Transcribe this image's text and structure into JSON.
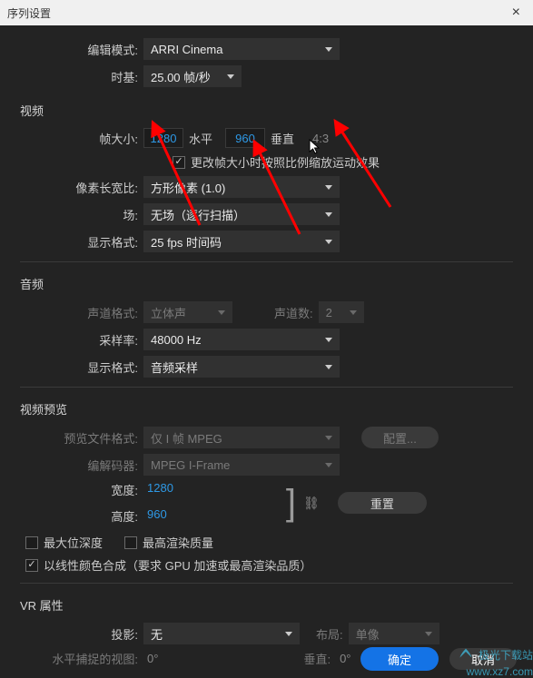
{
  "window": {
    "title": "序列设置",
    "close": "×"
  },
  "header": {
    "edit_mode_label": "编辑模式:",
    "edit_mode_value": "ARRI Cinema",
    "timebase_label": "时基:",
    "timebase_value": "25.00 帧/秒"
  },
  "video": {
    "section": "视频",
    "frame_size_label": "帧大小:",
    "width": "1280",
    "horiz_label": "水平",
    "height": "960",
    "vert_label": "垂直",
    "aspect": "4:3",
    "scale_checkbox_label": "更改帧大小时按照比例缩放运动效果",
    "pixel_aspect_label": "像素长宽比:",
    "pixel_aspect_value": "方形像素 (1.0)",
    "field_label": "场:",
    "field_value": "无场（逐行扫描）",
    "display_format_label": "显示格式:",
    "display_format_value": "25 fps 时间码"
  },
  "audio": {
    "section": "音频",
    "channel_format_label": "声道格式:",
    "channel_format_value": "立体声",
    "channel_count_label": "声道数:",
    "channel_count_value": "2",
    "sample_rate_label": "采样率:",
    "sample_rate_value": "48000 Hz",
    "display_format_label": "显示格式:",
    "display_format_value": "音频采样"
  },
  "preview": {
    "section": "视频预览",
    "file_format_label": "预览文件格式:",
    "file_format_value": "仅 I 帧 MPEG",
    "config_btn": "配置...",
    "codec_label": "编解码器:",
    "codec_value": "MPEG I-Frame",
    "width_label": "宽度:",
    "width_value": "1280",
    "height_label": "高度:",
    "height_value": "960",
    "reset_btn": "重置",
    "max_bit_depth_label": "最大位深度",
    "max_render_quality_label": "最高渲染质量",
    "linear_color_label": "以线性颜色合成（要求 GPU 加速或最高渲染品质）"
  },
  "vr": {
    "section": "VR 属性",
    "projection_label": "投影:",
    "projection_value": "无",
    "layout_label": "布局:",
    "layout_value": "单像",
    "horiz_capture_label": "水平捕捉的视图:",
    "horiz_capture_value": "0",
    "vert_label": "垂直:",
    "vert_value": "0",
    "degree": "°"
  },
  "footer": {
    "ok": "确定",
    "cancel": "取消"
  },
  "watermark": {
    "brand": "极光下载站",
    "url": "www.xz7.com"
  }
}
